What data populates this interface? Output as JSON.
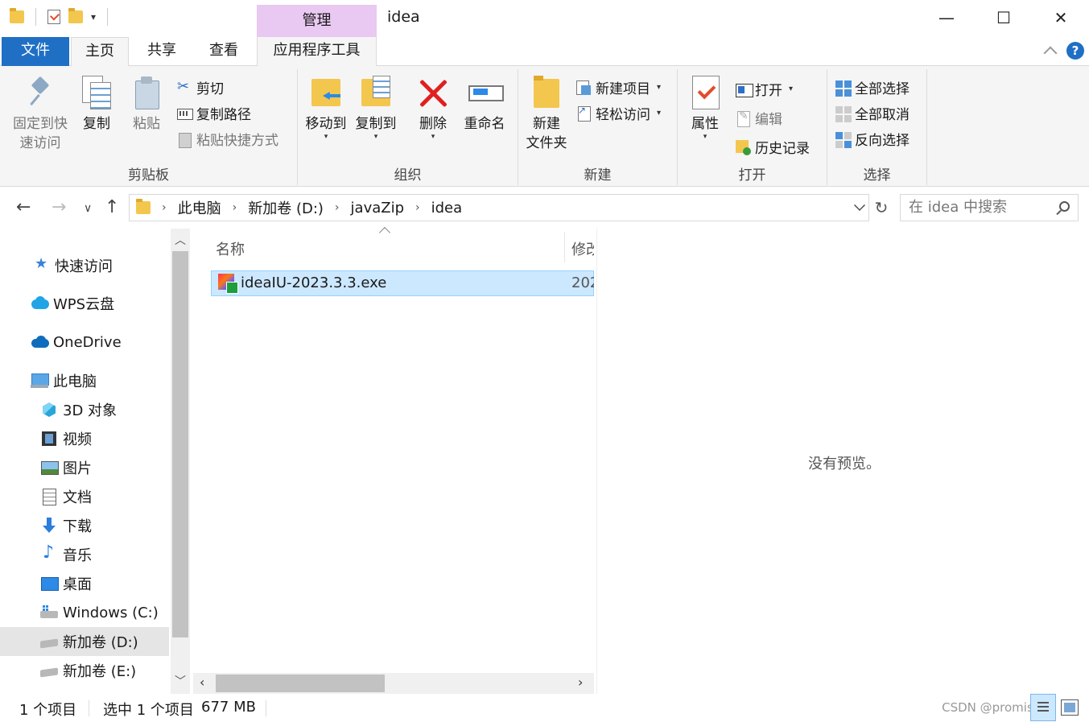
{
  "window": {
    "title": "idea",
    "context_tab_header": "管理",
    "controls": {
      "minimize": "—",
      "maximize": "☐",
      "close": "✕"
    }
  },
  "ribbon_tabs": [
    "文件",
    "主页",
    "共享",
    "查看",
    "应用程序工具"
  ],
  "ribbon": {
    "clipboard": {
      "label": "剪贴板",
      "pin": "固定到快\n速访问",
      "pin_l1": "固定到快",
      "pin_l2": "速访问",
      "copy": "复制",
      "paste": "粘贴",
      "cut": "剪切",
      "copy_path": "复制路径",
      "paste_shortcut": "粘贴快捷方式"
    },
    "organize": {
      "label": "组织",
      "move_to": "移动到",
      "copy_to": "复制到",
      "delete": "删除",
      "rename": "重命名"
    },
    "new": {
      "label": "新建",
      "new_folder_l1": "新建",
      "new_folder_l2": "文件夹",
      "new_item": "新建项目",
      "easy_access": "轻松访问"
    },
    "open": {
      "label": "打开",
      "properties": "属性",
      "open": "打开",
      "edit": "编辑",
      "history": "历史记录"
    },
    "select": {
      "label": "选择",
      "select_all": "全部选择",
      "select_none": "全部取消",
      "invert": "反向选择"
    }
  },
  "address": {
    "crumbs": [
      "此电脑",
      "新加卷 (D:)",
      "javaZip",
      "idea"
    ],
    "search_placeholder": "在 idea 中搜索"
  },
  "nav_pane": {
    "items": [
      {
        "label": "快速访问",
        "icon": "star-icon"
      },
      {
        "label": "WPS云盘",
        "icon": "cloud-icon"
      },
      {
        "label": "OneDrive",
        "icon": "onedrive-icon"
      },
      {
        "label": "此电脑",
        "icon": "computer-icon"
      },
      {
        "label": "3D 对象",
        "icon": "3d-objects-icon"
      },
      {
        "label": "视频",
        "icon": "video-icon"
      },
      {
        "label": "图片",
        "icon": "picture-icon"
      },
      {
        "label": "文档",
        "icon": "document-icon"
      },
      {
        "label": "下载",
        "icon": "download-icon"
      },
      {
        "label": "音乐",
        "icon": "music-icon"
      },
      {
        "label": "桌面",
        "icon": "desktop-icon"
      },
      {
        "label": "Windows (C:)",
        "icon": "windows-drive-icon"
      },
      {
        "label": "新加卷 (D:)",
        "icon": "drive-icon",
        "selected": true
      },
      {
        "label": "新加卷 (E:)",
        "icon": "drive-icon"
      }
    ]
  },
  "file_list": {
    "columns": {
      "name": "名称",
      "modified": "修改日期"
    },
    "rows": [
      {
        "name": "ideaIU-2023.3.3.exe",
        "modified": "202",
        "selected": true
      }
    ]
  },
  "preview": {
    "empty_text": "没有预览。"
  },
  "status_bar": {
    "item_count": "1 个项目",
    "selected": "选中 1 个项目",
    "size": "677 MB",
    "watermark": "CSDN @promise"
  }
}
